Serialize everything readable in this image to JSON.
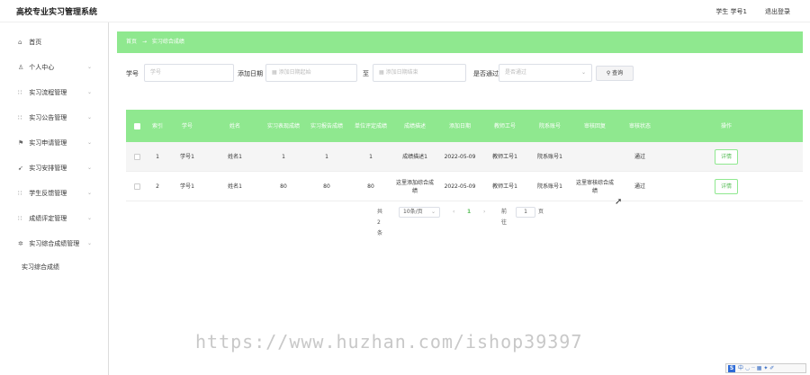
{
  "header": {
    "title": "高校专业实习管理系统",
    "user": "学生 学号1",
    "logout": "退出登录"
  },
  "sidebar": {
    "items": [
      {
        "icon": "home-icon",
        "glyph": "⌂",
        "label": "首页",
        "chevron": ""
      },
      {
        "icon": "user-icon",
        "glyph": "♙",
        "label": "个人中心",
        "chevron": "⌄"
      },
      {
        "icon": "grid-icon",
        "glyph": "∷",
        "label": "实习流程管理",
        "chevron": "⌄"
      },
      {
        "icon": "grid-icon",
        "glyph": "∷",
        "label": "实习公告管理",
        "chevron": "⌄"
      },
      {
        "icon": "flag-icon",
        "glyph": "⚑",
        "label": "实习申请管理",
        "chevron": "⌄"
      },
      {
        "icon": "send-icon",
        "glyph": "➹",
        "label": "实习安排管理",
        "chevron": "⌄"
      },
      {
        "icon": "grid-icon",
        "glyph": "∷",
        "label": "学生反馈管理",
        "chevron": "⌄"
      },
      {
        "icon": "grid-icon",
        "glyph": "∷",
        "label": "成绩评定管理",
        "chevron": "⌄"
      },
      {
        "icon": "gear-icon",
        "glyph": "✲",
        "label": "实习综合成绩管理",
        "chevron": "⌄"
      }
    ],
    "submenu": "实习综合成绩"
  },
  "breadcrumb": {
    "home": "首页",
    "sep": "→",
    "current": "实习综合成绩"
  },
  "search": {
    "xuehao_label": "学号",
    "xuehao_placeholder": "学号",
    "date_label": "添加日期",
    "date_start_placeholder": "添加日期起始",
    "to_label": "至",
    "date_end_placeholder": "添加日期结束",
    "passed_label": "是否通过",
    "passed_placeholder": "是否通过",
    "query_button": "查询"
  },
  "table": {
    "headers": [
      "",
      "索引",
      "学号",
      "姓名",
      "实习表现成绩",
      "实习报告成绩",
      "单位评定成绩",
      "成绩描述",
      "添加日期",
      "教师工号",
      "院系账号",
      "审核回复",
      "审核状态",
      "操作"
    ],
    "rows": [
      {
        "index": "1",
        "xuehao": "学号1",
        "name": "姓名1",
        "perf": "1",
        "report": "1",
        "unit": "1",
        "desc": "成绩描述1",
        "date": "2022-05-09",
        "teacher": "教师工号1",
        "dept": "院系账号1",
        "reply": "",
        "status": "通过",
        "action": "详情"
      },
      {
        "index": "2",
        "xuehao": "学号1",
        "name": "姓名1",
        "perf": "80",
        "report": "80",
        "unit": "80",
        "desc": "这里添加综合成绩",
        "date": "2022-05-09",
        "teacher": "教师工号1",
        "dept": "院系账号1",
        "reply": "这里审核综合成绩",
        "status": "通过",
        "action": "详情"
      }
    ]
  },
  "pager": {
    "total": "共 2 条",
    "page_size": "10条/页",
    "prev": "‹",
    "current": "1",
    "next": "›",
    "goto_label": "前往",
    "goto_value": "1",
    "page_suffix": "页"
  },
  "watermark": "https://www.huzhan.com/ishop39397",
  "tray": "中 ◡ ·· ▦ ✦ ✐",
  "colors": {
    "accent": "#8fe88f",
    "accent_text": "#5bbf5b"
  }
}
